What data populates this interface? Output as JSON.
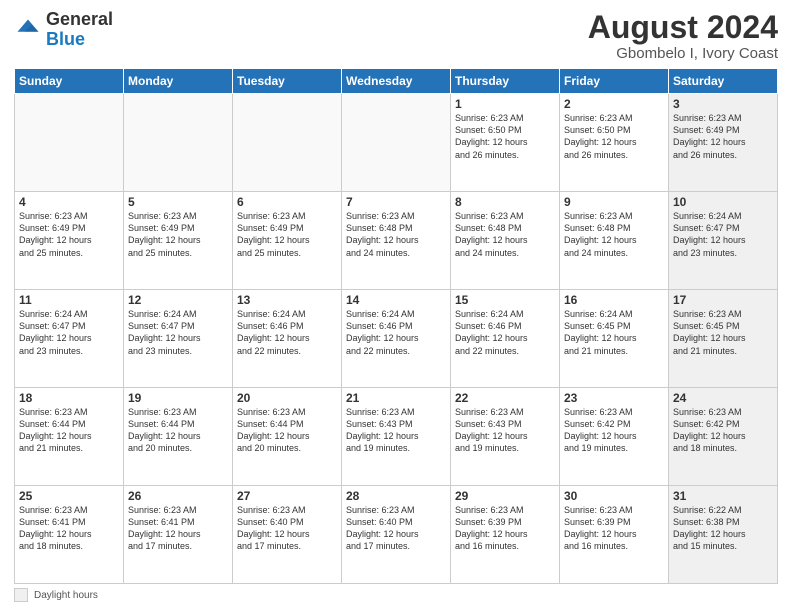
{
  "header": {
    "logo_general": "General",
    "logo_blue": "Blue",
    "title": "August 2024",
    "subtitle": "Gbombelo I, Ivory Coast"
  },
  "footer": {
    "shaded_label": "Daylight hours"
  },
  "days_of_week": [
    "Sunday",
    "Monday",
    "Tuesday",
    "Wednesday",
    "Thursday",
    "Friday",
    "Saturday"
  ],
  "weeks": [
    [
      {
        "day": "",
        "info": "",
        "shaded": false,
        "empty": true
      },
      {
        "day": "",
        "info": "",
        "shaded": false,
        "empty": true
      },
      {
        "day": "",
        "info": "",
        "shaded": false,
        "empty": true
      },
      {
        "day": "",
        "info": "",
        "shaded": false,
        "empty": true
      },
      {
        "day": "1",
        "info": "Sunrise: 6:23 AM\nSunset: 6:50 PM\nDaylight: 12 hours\nand 26 minutes.",
        "shaded": false,
        "empty": false
      },
      {
        "day": "2",
        "info": "Sunrise: 6:23 AM\nSunset: 6:50 PM\nDaylight: 12 hours\nand 26 minutes.",
        "shaded": false,
        "empty": false
      },
      {
        "day": "3",
        "info": "Sunrise: 6:23 AM\nSunset: 6:49 PM\nDaylight: 12 hours\nand 26 minutes.",
        "shaded": true,
        "empty": false
      }
    ],
    [
      {
        "day": "4",
        "info": "Sunrise: 6:23 AM\nSunset: 6:49 PM\nDaylight: 12 hours\nand 25 minutes.",
        "shaded": false,
        "empty": false
      },
      {
        "day": "5",
        "info": "Sunrise: 6:23 AM\nSunset: 6:49 PM\nDaylight: 12 hours\nand 25 minutes.",
        "shaded": false,
        "empty": false
      },
      {
        "day": "6",
        "info": "Sunrise: 6:23 AM\nSunset: 6:49 PM\nDaylight: 12 hours\nand 25 minutes.",
        "shaded": false,
        "empty": false
      },
      {
        "day": "7",
        "info": "Sunrise: 6:23 AM\nSunset: 6:48 PM\nDaylight: 12 hours\nand 24 minutes.",
        "shaded": false,
        "empty": false
      },
      {
        "day": "8",
        "info": "Sunrise: 6:23 AM\nSunset: 6:48 PM\nDaylight: 12 hours\nand 24 minutes.",
        "shaded": false,
        "empty": false
      },
      {
        "day": "9",
        "info": "Sunrise: 6:23 AM\nSunset: 6:48 PM\nDaylight: 12 hours\nand 24 minutes.",
        "shaded": false,
        "empty": false
      },
      {
        "day": "10",
        "info": "Sunrise: 6:24 AM\nSunset: 6:47 PM\nDaylight: 12 hours\nand 23 minutes.",
        "shaded": true,
        "empty": false
      }
    ],
    [
      {
        "day": "11",
        "info": "Sunrise: 6:24 AM\nSunset: 6:47 PM\nDaylight: 12 hours\nand 23 minutes.",
        "shaded": false,
        "empty": false
      },
      {
        "day": "12",
        "info": "Sunrise: 6:24 AM\nSunset: 6:47 PM\nDaylight: 12 hours\nand 23 minutes.",
        "shaded": false,
        "empty": false
      },
      {
        "day": "13",
        "info": "Sunrise: 6:24 AM\nSunset: 6:46 PM\nDaylight: 12 hours\nand 22 minutes.",
        "shaded": false,
        "empty": false
      },
      {
        "day": "14",
        "info": "Sunrise: 6:24 AM\nSunset: 6:46 PM\nDaylight: 12 hours\nand 22 minutes.",
        "shaded": false,
        "empty": false
      },
      {
        "day": "15",
        "info": "Sunrise: 6:24 AM\nSunset: 6:46 PM\nDaylight: 12 hours\nand 22 minutes.",
        "shaded": false,
        "empty": false
      },
      {
        "day": "16",
        "info": "Sunrise: 6:24 AM\nSunset: 6:45 PM\nDaylight: 12 hours\nand 21 minutes.",
        "shaded": false,
        "empty": false
      },
      {
        "day": "17",
        "info": "Sunrise: 6:23 AM\nSunset: 6:45 PM\nDaylight: 12 hours\nand 21 minutes.",
        "shaded": true,
        "empty": false
      }
    ],
    [
      {
        "day": "18",
        "info": "Sunrise: 6:23 AM\nSunset: 6:44 PM\nDaylight: 12 hours\nand 21 minutes.",
        "shaded": false,
        "empty": false
      },
      {
        "day": "19",
        "info": "Sunrise: 6:23 AM\nSunset: 6:44 PM\nDaylight: 12 hours\nand 20 minutes.",
        "shaded": false,
        "empty": false
      },
      {
        "day": "20",
        "info": "Sunrise: 6:23 AM\nSunset: 6:44 PM\nDaylight: 12 hours\nand 20 minutes.",
        "shaded": false,
        "empty": false
      },
      {
        "day": "21",
        "info": "Sunrise: 6:23 AM\nSunset: 6:43 PM\nDaylight: 12 hours\nand 19 minutes.",
        "shaded": false,
        "empty": false
      },
      {
        "day": "22",
        "info": "Sunrise: 6:23 AM\nSunset: 6:43 PM\nDaylight: 12 hours\nand 19 minutes.",
        "shaded": false,
        "empty": false
      },
      {
        "day": "23",
        "info": "Sunrise: 6:23 AM\nSunset: 6:42 PM\nDaylight: 12 hours\nand 19 minutes.",
        "shaded": false,
        "empty": false
      },
      {
        "day": "24",
        "info": "Sunrise: 6:23 AM\nSunset: 6:42 PM\nDaylight: 12 hours\nand 18 minutes.",
        "shaded": true,
        "empty": false
      }
    ],
    [
      {
        "day": "25",
        "info": "Sunrise: 6:23 AM\nSunset: 6:41 PM\nDaylight: 12 hours\nand 18 minutes.",
        "shaded": false,
        "empty": false
      },
      {
        "day": "26",
        "info": "Sunrise: 6:23 AM\nSunset: 6:41 PM\nDaylight: 12 hours\nand 17 minutes.",
        "shaded": false,
        "empty": false
      },
      {
        "day": "27",
        "info": "Sunrise: 6:23 AM\nSunset: 6:40 PM\nDaylight: 12 hours\nand 17 minutes.",
        "shaded": false,
        "empty": false
      },
      {
        "day": "28",
        "info": "Sunrise: 6:23 AM\nSunset: 6:40 PM\nDaylight: 12 hours\nand 17 minutes.",
        "shaded": false,
        "empty": false
      },
      {
        "day": "29",
        "info": "Sunrise: 6:23 AM\nSunset: 6:39 PM\nDaylight: 12 hours\nand 16 minutes.",
        "shaded": false,
        "empty": false
      },
      {
        "day": "30",
        "info": "Sunrise: 6:23 AM\nSunset: 6:39 PM\nDaylight: 12 hours\nand 16 minutes.",
        "shaded": false,
        "empty": false
      },
      {
        "day": "31",
        "info": "Sunrise: 6:22 AM\nSunset: 6:38 PM\nDaylight: 12 hours\nand 15 minutes.",
        "shaded": true,
        "empty": false
      }
    ]
  ]
}
